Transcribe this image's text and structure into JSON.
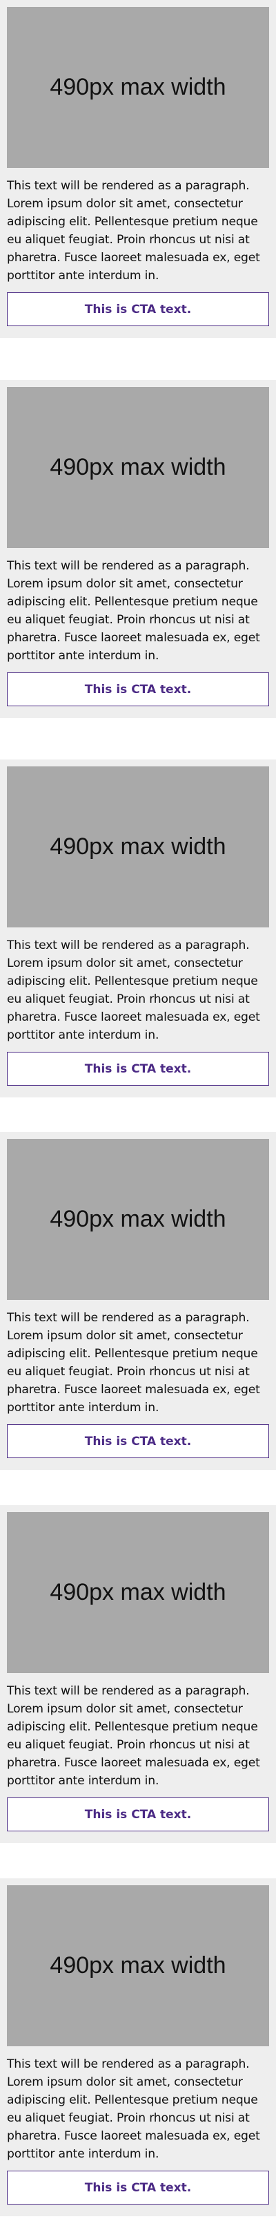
{
  "cards": [
    {
      "image_label": "490px max width",
      "paragraph": "This text will be rendered as a paragraph. Lorem ipsum dolor sit amet, consectetur adipiscing elit. Pellentesque pretium neque eu aliquet feugiat. Proin rhoncus ut nisi at pharetra. Fusce laoreet malesuada ex, eget porttitor ante interdum in.",
      "cta_label": "This is CTA text."
    },
    {
      "image_label": "490px max width",
      "paragraph": "This text will be rendered as a paragraph. Lorem ipsum dolor sit amet, consectetur adipiscing elit. Pellentesque pretium neque eu aliquet feugiat. Proin rhoncus ut nisi at pharetra. Fusce laoreet malesuada ex, eget porttitor ante interdum in.",
      "cta_label": "This is CTA text."
    },
    {
      "image_label": "490px max width",
      "paragraph": "This text will be rendered as a paragraph. Lorem ipsum dolor sit amet, consectetur adipiscing elit. Pellentesque pretium neque eu aliquet feugiat. Proin rhoncus ut nisi at pharetra. Fusce laoreet malesuada ex, eget porttitor ante interdum in.",
      "cta_label": "This is CTA text."
    },
    {
      "image_label": "490px max width",
      "paragraph": "This text will be rendered as a paragraph. Lorem ipsum dolor sit amet, consectetur adipiscing elit. Pellentesque pretium neque eu aliquet feugiat. Proin rhoncus ut nisi at pharetra. Fusce laoreet malesuada ex, eget porttitor ante interdum in.",
      "cta_label": "This is CTA text."
    },
    {
      "image_label": "490px max width",
      "paragraph": "This text will be rendered as a paragraph. Lorem ipsum dolor sit amet, consectetur adipiscing elit. Pellentesque pretium neque eu aliquet feugiat. Proin rhoncus ut nisi at pharetra. Fusce laoreet malesuada ex, eget porttitor ante interdum in.",
      "cta_label": "This is CTA text."
    },
    {
      "image_label": "490px max width",
      "paragraph": "This text will be rendered as a paragraph. Lorem ipsum dolor sit amet, consectetur adipiscing elit. Pellentesque pretium neque eu aliquet feugiat. Proin rhoncus ut nisi at pharetra. Fusce laoreet malesuada ex, eget porttitor ante interdum in.",
      "cta_label": "This is CTA text."
    }
  ],
  "colors": {
    "card_background": "#eeeeee",
    "image_placeholder": "#a9a9a9",
    "cta_accent": "#4b2a85",
    "text": "#111111"
  }
}
